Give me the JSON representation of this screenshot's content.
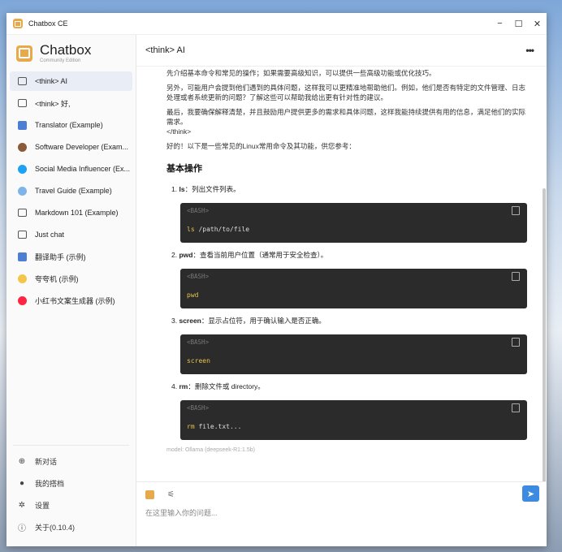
{
  "window": {
    "title": "Chatbox CE"
  },
  "brand": {
    "name": "Chatbox",
    "subtitle": "Community Edition"
  },
  "sessions": [
    {
      "label": "<think> AI",
      "icon": "chat-bubble-icon",
      "active": true
    },
    {
      "label": "<think> 好,",
      "icon": "chat-bubble-icon"
    },
    {
      "label": "Translator (Example)",
      "icon": "translator-avatar-icon"
    },
    {
      "label": "Software Developer (Exam...",
      "icon": "developer-avatar-icon"
    },
    {
      "label": "Social Media Influencer (Ex...",
      "icon": "twitter-avatar-icon"
    },
    {
      "label": "Travel Guide (Example)",
      "icon": "globe-avatar-icon"
    },
    {
      "label": "Markdown 101 (Example)",
      "icon": "chat-bubble-icon"
    },
    {
      "label": "Just chat",
      "icon": "chat-bubble-icon"
    },
    {
      "label": "翻译助手 (示例)",
      "icon": "translator-avatar-icon"
    },
    {
      "label": "夸夸机 (示例)",
      "icon": "sparkle-avatar-icon"
    },
    {
      "label": "小红书文案生成器 (示例)",
      "icon": "xiaohongshu-avatar-icon"
    }
  ],
  "footer": {
    "new_chat": "新对话",
    "my_copilots": "我的搭档",
    "settings": "设置",
    "about": "关于(0.10.4)"
  },
  "header": {
    "title": "<think> AI",
    "more": "•••"
  },
  "message": {
    "paragraphs": [
      "先介绍基本命令和常见的操作；如果需要高级知识，可以提供一些高级功能或优化技巧。",
      "另外，可能用户会提到他们遇到的具体问题，这样我可以更精准地帮助他们。例如，他们是否有特定的文件管理、日志处理或者系统更新的问题？了解这些可以帮助我给出更有针对性的建议。",
      "最后，我要确保解释清楚，并且鼓励用户提供更多的需求和具体问题，这样我能持续提供有用的信息，满足他们的实际需求。",
      "</think>",
      "好的！以下是一些常见的Linux常用命令及其功能，供您参考："
    ],
    "heading": "基本操作",
    "commands": [
      {
        "num": "1.",
        "name": "ls",
        "desc": "：列出文件列表。",
        "lang": "<BASH>",
        "code_kw": "ls",
        "code_rest": " /path/to/file"
      },
      {
        "num": "2.",
        "name": "pwd",
        "desc": "：查看当前用户位置（通常用于安全检查）。",
        "lang": "<BASH>",
        "code_kw": "pwd",
        "code_rest": ""
      },
      {
        "num": "3.",
        "name": "screen",
        "desc": "：显示占位符，用于确认输入是否正确。",
        "lang": "<BASH>",
        "code_kw": "screen",
        "code_rest": ""
      },
      {
        "num": "4.",
        "name": "rm",
        "desc": "：删除文件或 directory。",
        "lang": "<BASH>",
        "code_kw": "rm",
        "code_rest": " file.txt..."
      }
    ],
    "model_note": "model: Ollama (deepseek-R1:1.5b)"
  },
  "composer": {
    "placeholder": "在这里输入你的问题..."
  }
}
